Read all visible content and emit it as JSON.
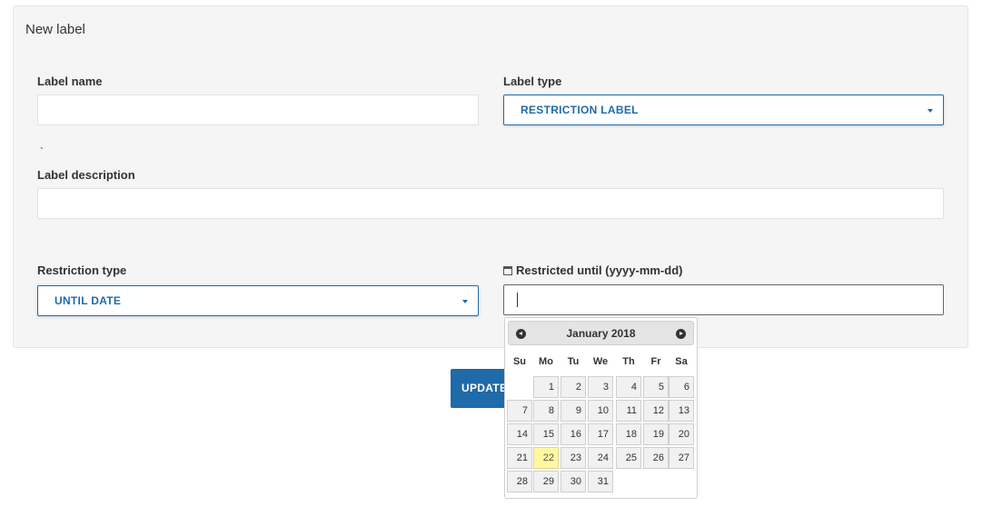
{
  "form": {
    "title": "New label",
    "label_name": {
      "label": "Label name",
      "value": ""
    },
    "label_type": {
      "label": "Label type",
      "value": "RESTRICTION LABEL"
    },
    "stray_mark": "`",
    "label_description": {
      "label": "Label description",
      "value": ""
    },
    "restriction_type": {
      "label": "Restriction type",
      "value": "UNTIL DATE"
    },
    "restricted_until": {
      "label": "Restricted until (yyyy-mm-dd)",
      "value": ""
    },
    "update_button": "UPDATE"
  },
  "datepicker": {
    "month_label": "January 2018",
    "weekdays": [
      "Su",
      "Mo",
      "Tu",
      "We",
      "Th",
      "Fr",
      "Sa"
    ],
    "first_weekday_index": 1,
    "days": [
      "1",
      "2",
      "3",
      "4",
      "5",
      "6",
      "7",
      "8",
      "9",
      "10",
      "11",
      "12",
      "13",
      "14",
      "15",
      "16",
      "17",
      "18",
      "19",
      "20",
      "21",
      "22",
      "23",
      "24",
      "25",
      "26",
      "27",
      "28",
      "29",
      "30",
      "31"
    ],
    "highlighted_day": "22"
  },
  "colors": {
    "accent": "#1f6aa8",
    "highlight": "#fff8a0",
    "panel_bg": "#f5f5f6"
  },
  "icons": {
    "calendar": "calendar-icon",
    "dropdown": "chevron-down-icon",
    "prev_month": "prev-month-icon",
    "next_month": "next-month-icon"
  }
}
